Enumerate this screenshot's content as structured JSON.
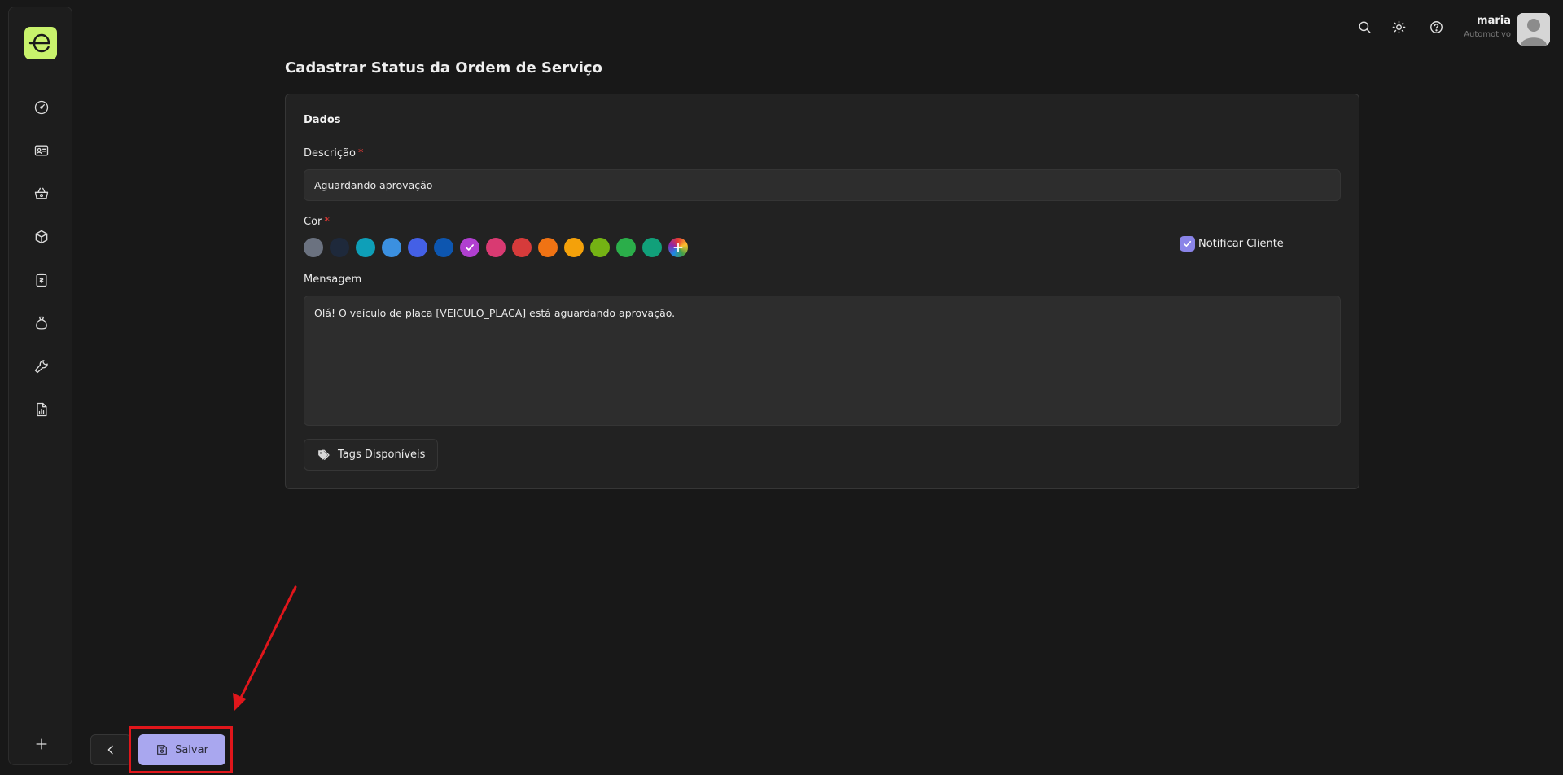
{
  "header": {
    "user_name": "maria",
    "user_company": "Automotivo"
  },
  "sidebar": {
    "items": [
      {
        "icon": "dashboard-icon"
      },
      {
        "icon": "contact-card-icon"
      },
      {
        "icon": "basket-icon"
      },
      {
        "icon": "box-icon"
      },
      {
        "icon": "clipboard-icon"
      },
      {
        "icon": "money-bag-icon"
      },
      {
        "icon": "wrench-icon"
      },
      {
        "icon": "report-icon"
      }
    ],
    "add_icon": "plus-icon"
  },
  "page": {
    "title": "Cadastrar Status da Ordem de Serviço",
    "section_title": "Dados",
    "description_label": "Descrição",
    "description_value": "Aguardando aprovação",
    "color_label": "Cor",
    "required_mark": "*",
    "colors": [
      "#6b7280",
      "#1e293b",
      "#0e9fb8",
      "#3b90e0",
      "#4460e6",
      "#0d56b0",
      "#b03fd0",
      "#d93a72",
      "#d63b3b",
      "#f07314",
      "#f4a10a",
      "#74b214",
      "#2bae4a",
      "#11a07a",
      "rainbow"
    ],
    "selected_color_index": 6,
    "notify_label": "Notificar Cliente",
    "notify_checked": true,
    "message_label": "Mensagem",
    "message_value": "Olá! O veículo de placa [VEICULO_PLACA] está aguardando aprovação.",
    "tags_button": "Tags Disponíveis"
  },
  "actions": {
    "save_label": "Salvar"
  },
  "colors": {
    "accent": "#a9a7ef",
    "logo": "#c8f26c",
    "highlight": "#e0161b"
  }
}
